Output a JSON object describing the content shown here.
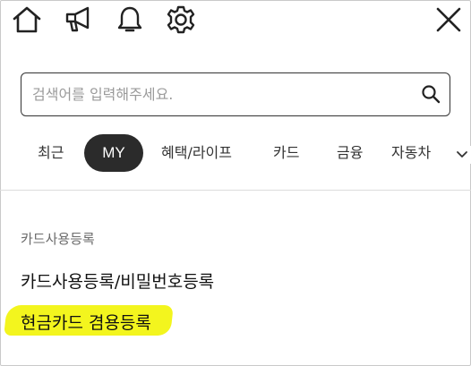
{
  "topbar": {
    "icons": [
      "home-icon",
      "megaphone-icon",
      "bell-icon",
      "gear-icon",
      "close-icon"
    ]
  },
  "search": {
    "placeholder": "검색어를 입력해주세요."
  },
  "tabs": {
    "items": [
      "최근",
      "MY",
      "혜택/라이프",
      "카드",
      "금융",
      "자동차"
    ],
    "active": "MY"
  },
  "menu": {
    "section_label": "카드사용등록",
    "links": [
      "카드사용등록/비밀번호등록",
      "현금카드 겸용등록"
    ],
    "highlight_color": "#f3f51e"
  },
  "colors": {
    "active_tab_bg": "#2b2b2b",
    "text": "#222222"
  }
}
